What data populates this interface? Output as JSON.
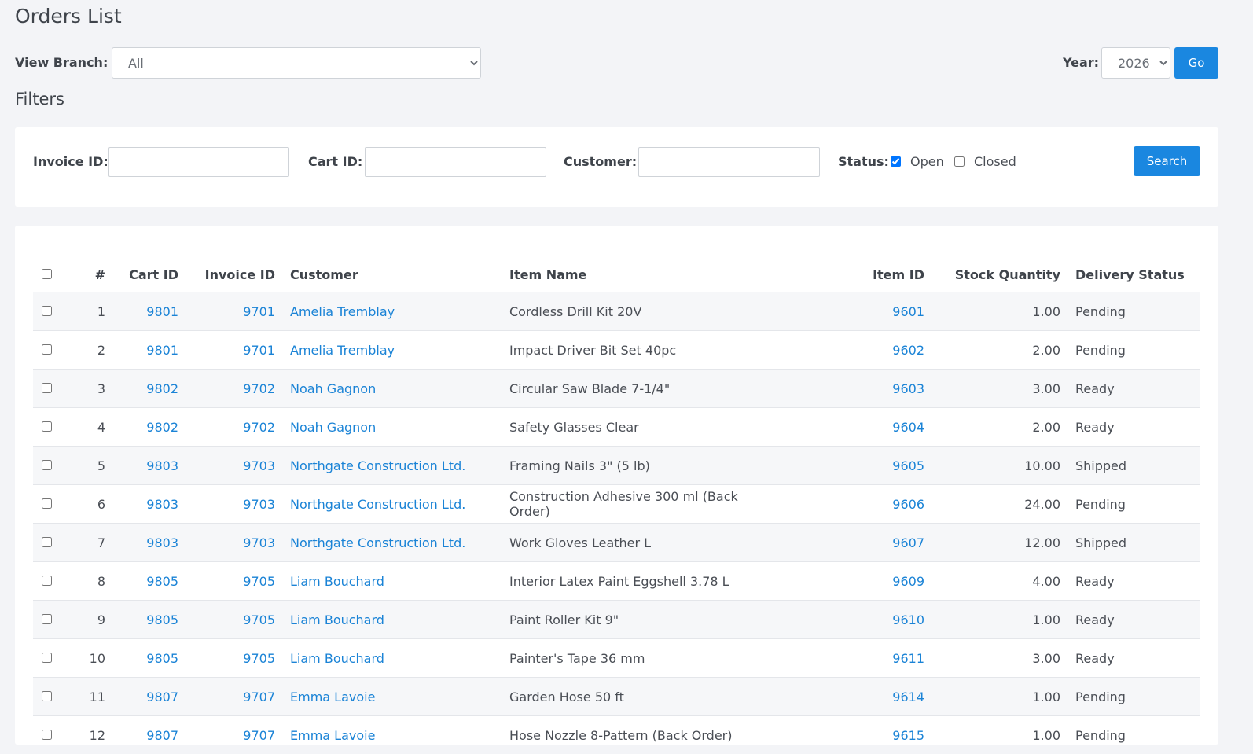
{
  "page": {
    "title": "Orders List",
    "filters_title": "Filters"
  },
  "branch": {
    "label": "View Branch:",
    "value": "All"
  },
  "year": {
    "label": "Year:",
    "value": "2026",
    "go_label": "Go"
  },
  "filters": {
    "invoice_label": "Invoice ID:",
    "cart_label": "Cart ID:",
    "customer_label": "Customer:",
    "status_label": "Status:",
    "open_label": "Open",
    "open_checked": true,
    "closed_label": "Closed",
    "closed_checked": false,
    "search_label": "Search"
  },
  "table": {
    "headers": {
      "num": "#",
      "cart": "Cart ID",
      "invoice": "Invoice ID",
      "customer": "Customer",
      "item_name": "Item Name",
      "item_id": "Item ID",
      "stock": "Stock Quantity",
      "delivery": "Delivery Status"
    },
    "rows": [
      {
        "num": "1",
        "cart": "9801",
        "invoice": "9701",
        "customer": "Amelia Tremblay",
        "item_name": "Cordless Drill Kit 20V",
        "item_id": "9601",
        "stock": "1.00",
        "delivery": "Pending"
      },
      {
        "num": "2",
        "cart": "9801",
        "invoice": "9701",
        "customer": "Amelia Tremblay",
        "item_name": "Impact Driver Bit Set 40pc",
        "item_id": "9602",
        "stock": "2.00",
        "delivery": "Pending"
      },
      {
        "num": "3",
        "cart": "9802",
        "invoice": "9702",
        "customer": "Noah Gagnon",
        "item_name": "Circular Saw Blade 7-1/4\"",
        "item_id": "9603",
        "stock": "3.00",
        "delivery": "Ready"
      },
      {
        "num": "4",
        "cart": "9802",
        "invoice": "9702",
        "customer": "Noah Gagnon",
        "item_name": "Safety Glasses Clear",
        "item_id": "9604",
        "stock": "2.00",
        "delivery": "Ready"
      },
      {
        "num": "5",
        "cart": "9803",
        "invoice": "9703",
        "customer": "Northgate Construction Ltd.",
        "item_name": "Framing Nails 3\" (5 lb)",
        "item_id": "9605",
        "stock": "10.00",
        "delivery": "Shipped"
      },
      {
        "num": "6",
        "cart": "9803",
        "invoice": "9703",
        "customer": "Northgate Construction Ltd.",
        "item_name": "Construction Adhesive 300 ml (Back Order)",
        "item_id": "9606",
        "stock": "24.00",
        "delivery": "Pending"
      },
      {
        "num": "7",
        "cart": "9803",
        "invoice": "9703",
        "customer": "Northgate Construction Ltd.",
        "item_name": "Work Gloves Leather L",
        "item_id": "9607",
        "stock": "12.00",
        "delivery": "Shipped"
      },
      {
        "num": "8",
        "cart": "9805",
        "invoice": "9705",
        "customer": "Liam Bouchard",
        "item_name": "Interior Latex Paint Eggshell 3.78 L",
        "item_id": "9609",
        "stock": "4.00",
        "delivery": "Ready"
      },
      {
        "num": "9",
        "cart": "9805",
        "invoice": "9705",
        "customer": "Liam Bouchard",
        "item_name": "Paint Roller Kit 9\"",
        "item_id": "9610",
        "stock": "1.00",
        "delivery": "Ready"
      },
      {
        "num": "10",
        "cart": "9805",
        "invoice": "9705",
        "customer": "Liam Bouchard",
        "item_name": "Painter's Tape 36 mm",
        "item_id": "9611",
        "stock": "3.00",
        "delivery": "Ready"
      },
      {
        "num": "11",
        "cart": "9807",
        "invoice": "9707",
        "customer": "Emma Lavoie",
        "item_name": "Garden Hose 50 ft",
        "item_id": "9614",
        "stock": "1.00",
        "delivery": "Pending"
      },
      {
        "num": "12",
        "cart": "9807",
        "invoice": "9707",
        "customer": "Emma Lavoie",
        "item_name": "Hose Nozzle 8-Pattern (Back Order)",
        "item_id": "9615",
        "stock": "1.00",
        "delivery": "Pending"
      }
    ]
  },
  "colors": {
    "accent": "#1a87e0",
    "link": "#1a83d6",
    "background": "#f3f4f7"
  }
}
